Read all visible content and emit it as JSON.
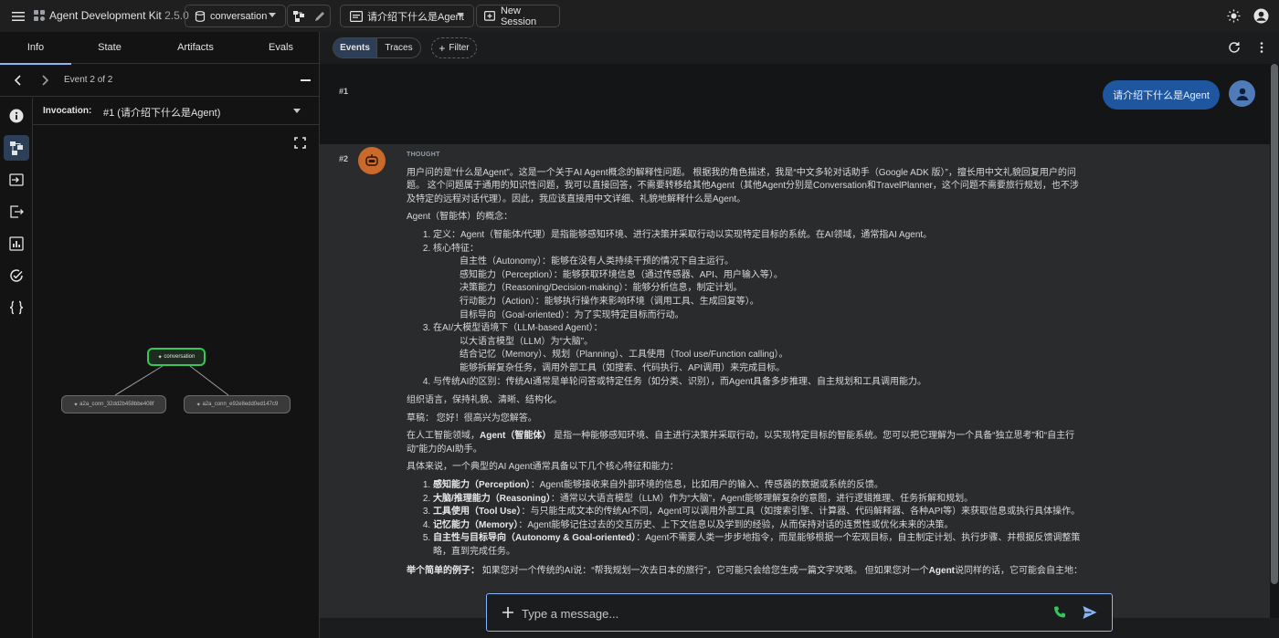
{
  "app": {
    "name": "Agent Development Kit",
    "version": "2.5.0"
  },
  "header": {
    "agent": "conversation",
    "session": "请介绍下什么是Agent",
    "new_session": "New Session"
  },
  "left_tabs": [
    "Info",
    "State",
    "Artifacts",
    "Evals"
  ],
  "event_nav": {
    "label": "Event 2 of 2"
  },
  "invocation": {
    "label": "Invocation:",
    "value": "#1 (请介绍下什么是Agent)"
  },
  "graph": {
    "root": "conversation",
    "children": [
      "a2a_conn_32dd2b458bbe408f",
      "a2a_conn_e92e8edd0ed147c9"
    ]
  },
  "toolbar": {
    "events": "Events",
    "traces": "Traces",
    "filter": "Filter"
  },
  "chat": {
    "row1_index": "#1",
    "user_message": "请介绍下什么是Agent",
    "row2_index": "#2",
    "thought_label": "THOUGHT",
    "p1": "用户问的是“什么是Agent”。这是一个关于AI Agent概念的解释性问题。 根据我的角色描述，我是“中文多轮对话助手（Google ADK 版）”，擅长用中文礼貌回复用户的问题。 这个问题属于通用的知识性问题，我可以直接回答，不需要转移给其他Agent（其他Agent分别是Conversation和TravelPlanner，这个问题不需要旅行规划，也不涉及特定的远程对话代理）。因此，我应该直接用中文详细、礼貌地解释什么是Agent。",
    "p2": "Agent（智能体）的概念：",
    "concept_list": [
      "定义：Agent（智能体/代理）是指能够感知环境、进行决策并采取行动以实现特定目标的系统。在AI领域，通常指AI Agent。",
      "核心特征：",
      "在AI/大模型语境下（LLM-based Agent）：",
      "与传统AI的区别：传统AI通常是单轮问答或特定任务（如分类、识别），而Agent具备多步推理、自主规划和工具调用能力。"
    ],
    "core_features": [
      "自主性（Autonomy）：能够在没有人类持续干预的情况下自主运行。",
      "感知能力（Perception）：能够获取环境信息（通过传感器、API、用户输入等）。",
      "决策能力（Reasoning/Decision-making）：能够分析信息，制定计划。",
      "行动能力（Action）：能够执行操作来影响环境（调用工具、生成回复等）。",
      "目标导向（Goal-oriented）：为了实现特定目标而行动。"
    ],
    "llm_context": [
      "以大语言模型（LLM）为“大脑”。",
      "结合记忆（Memory）、规划（Planning）、工具使用（Tool use/Function calling）。",
      "能够拆解复杂任务，调用外部工具（如搜索、代码执行、API调用）来完成目标。"
    ],
    "p3": "组织语言，保持礼貌、清晰、结构化。",
    "p4": "草稿： 您好！很高兴为您解答。",
    "p5_pre": "在人工智能领域，",
    "p5_bold": "Agent（智能体）",
    "p5_post": " 是指一种能够感知环境、自主进行决策并采取行动，以实现特定目标的智能系统。您可以把它理解为一个具备“独立思考”和“自主行动”能力的AI助手。",
    "p6": "具体来说，一个典型的AI Agent通常具备以下几个核心特征和能力：",
    "features": [
      {
        "title": "感知能力（Perception）",
        "text": "：Agent能够接收来自外部环境的信息，比如用户的输入、传感器的数据或系统的反馈。"
      },
      {
        "title": "大脑/推理能力（Reasoning）",
        "text": "：通常以大语言模型（LLM）作为“大脑”，Agent能够理解复杂的意图，进行逻辑推理、任务拆解和规划。"
      },
      {
        "title": "工具使用（Tool Use）",
        "text": "：与只能生成文本的传统AI不同，Agent可以调用外部工具（如搜索引擎、计算器、代码解释器、各种API等）来获取信息或执行具体操作。"
      },
      {
        "title": "记忆能力（Memory）",
        "text": "：Agent能够记住过去的交互历史、上下文信息以及学到的经验，从而保持对话的连贯性或优化未来的决策。"
      },
      {
        "title": "自主性与目标导向（Autonomy & Goal-oriented）",
        "text": "：Agent不需要人类一步步地指令，而是能够根据一个宏观目标，自主制定计划、执行步骤、并根据反馈调整策略，直到完成任务。"
      }
    ],
    "p7_bold": "举个简单的例子：",
    "p7_mid": " 如果您对一个传统的AI说：“帮我规划一次去日本的旅行”，它可能只会给您生成一篇文字攻略。 但如果您对一个",
    "p7_bold2": "Agent",
    "p7_post": "说同样的话，它可能会自主地："
  },
  "input": {
    "placeholder": "Type a message..."
  },
  "colors": {
    "accent": "#8ab4f8",
    "user_bubble": "#1e56a0",
    "graph_root_border": "#34c759"
  }
}
